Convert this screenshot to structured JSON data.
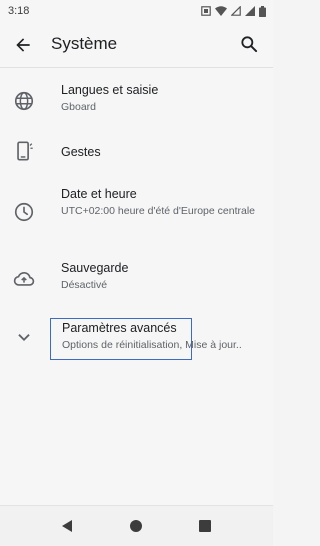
{
  "status_bar": {
    "time": "3:18"
  },
  "app_bar": {
    "title": "Système"
  },
  "settings": [
    {
      "id": "langues",
      "title": "Langues et saisie",
      "subtitle": "Gboard",
      "icon": "globe-icon"
    },
    {
      "id": "gestes",
      "title": "Gestes",
      "subtitle": "",
      "icon": "gestures-phone-icon"
    },
    {
      "id": "date",
      "title": "Date et heure",
      "subtitle": "UTC+02:00 heure d'été d'Europe centrale",
      "icon": "clock-icon"
    },
    {
      "id": "sauvegarde",
      "title": "Sauvegarde",
      "subtitle": "Désactivé",
      "icon": "cloud-upload-icon"
    },
    {
      "id": "avances",
      "title": "Paramètres avancés",
      "subtitle": "Options de réinitialisation, Mise à jour..",
      "icon": "chevron-down-icon"
    }
  ],
  "colors": {
    "focus_outline": "#3d6bc4",
    "text_primary": "#202124",
    "text_secondary": "#5f6368"
  }
}
